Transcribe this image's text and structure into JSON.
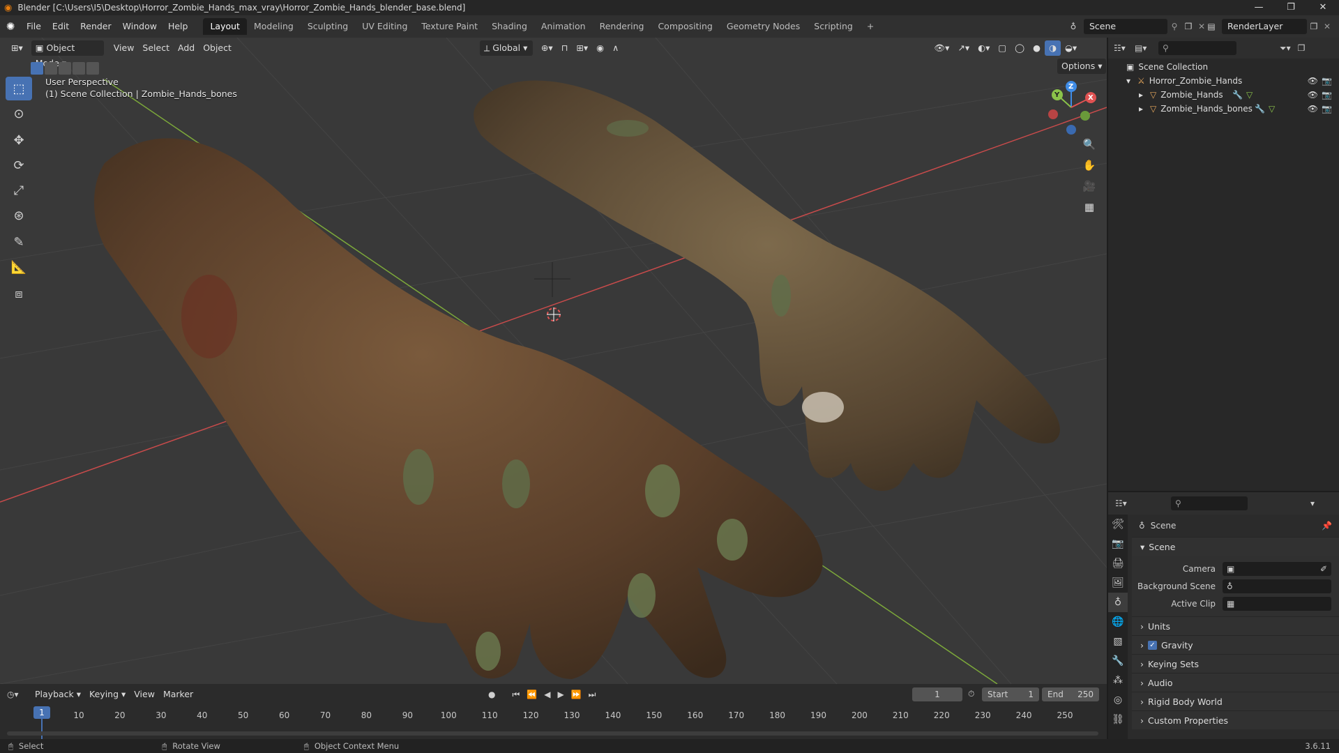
{
  "titlebar": {
    "title": "Blender [C:\\Users\\I5\\Desktop\\Horror_Zombie_Hands_max_vray\\Horror_Zombie_Hands_blender_base.blend]",
    "minimize": "—",
    "maximize": "❐",
    "close": "✕"
  },
  "menubar": {
    "menus": [
      "File",
      "Edit",
      "Render",
      "Window",
      "Help"
    ],
    "workspaces": [
      "Layout",
      "Modeling",
      "Sculpting",
      "UV Editing",
      "Texture Paint",
      "Shading",
      "Animation",
      "Rendering",
      "Compositing",
      "Geometry Nodes",
      "Scripting"
    ],
    "active_workspace": "Layout",
    "add_tab": "+",
    "scene": "Scene",
    "view_layer": "RenderLayer"
  },
  "viewport": {
    "mode": "Object Mode",
    "menus": [
      "View",
      "Select",
      "Add",
      "Object"
    ],
    "orientation": "Global",
    "options_label": "Options",
    "overlay_line1": "User Perspective",
    "overlay_line2": "(1) Scene Collection | Zombie_Hands_bones",
    "gizmo": {
      "z": "Z",
      "y": "Y",
      "x": "X"
    }
  },
  "outliner": {
    "root": "Scene Collection",
    "collection": "Horror_Zombie_Hands",
    "objects": [
      "Zombie_Hands",
      "Zombie_Hands_bones"
    ]
  },
  "properties": {
    "header": "Scene",
    "panel_scene": "Scene",
    "fields": {
      "camera": "Camera",
      "background_scene": "Background Scene",
      "active_clip": "Active Clip"
    },
    "subpanels": [
      "Units",
      "Gravity",
      "Keying Sets",
      "Audio",
      "Rigid Body World",
      "Custom Properties"
    ],
    "gravity_checked": true
  },
  "timeline": {
    "menus": [
      "Playback",
      "Keying",
      "View",
      "Marker"
    ],
    "current_frame": "1",
    "start_label": "Start",
    "start": "1",
    "end_label": "End",
    "end": "250",
    "ticks": [
      "1",
      "10",
      "20",
      "30",
      "40",
      "50",
      "60",
      "70",
      "80",
      "90",
      "100",
      "110",
      "120",
      "130",
      "140",
      "150",
      "160",
      "170",
      "180",
      "190",
      "200",
      "210",
      "220",
      "230",
      "240",
      "250"
    ]
  },
  "statusbar": {
    "select": "Select",
    "rotate": "Rotate View",
    "context": "Object Context Menu",
    "version": "3.6.11"
  },
  "colors": {
    "accent": "#4772b3",
    "viewport_bg": "#393939",
    "x_axis": "#c94b4b",
    "y_axis": "#7ca83a",
    "gizmo_z": "#3f8ce6",
    "gizmo_y": "#8bc34a",
    "gizmo_x": "#e05252"
  }
}
